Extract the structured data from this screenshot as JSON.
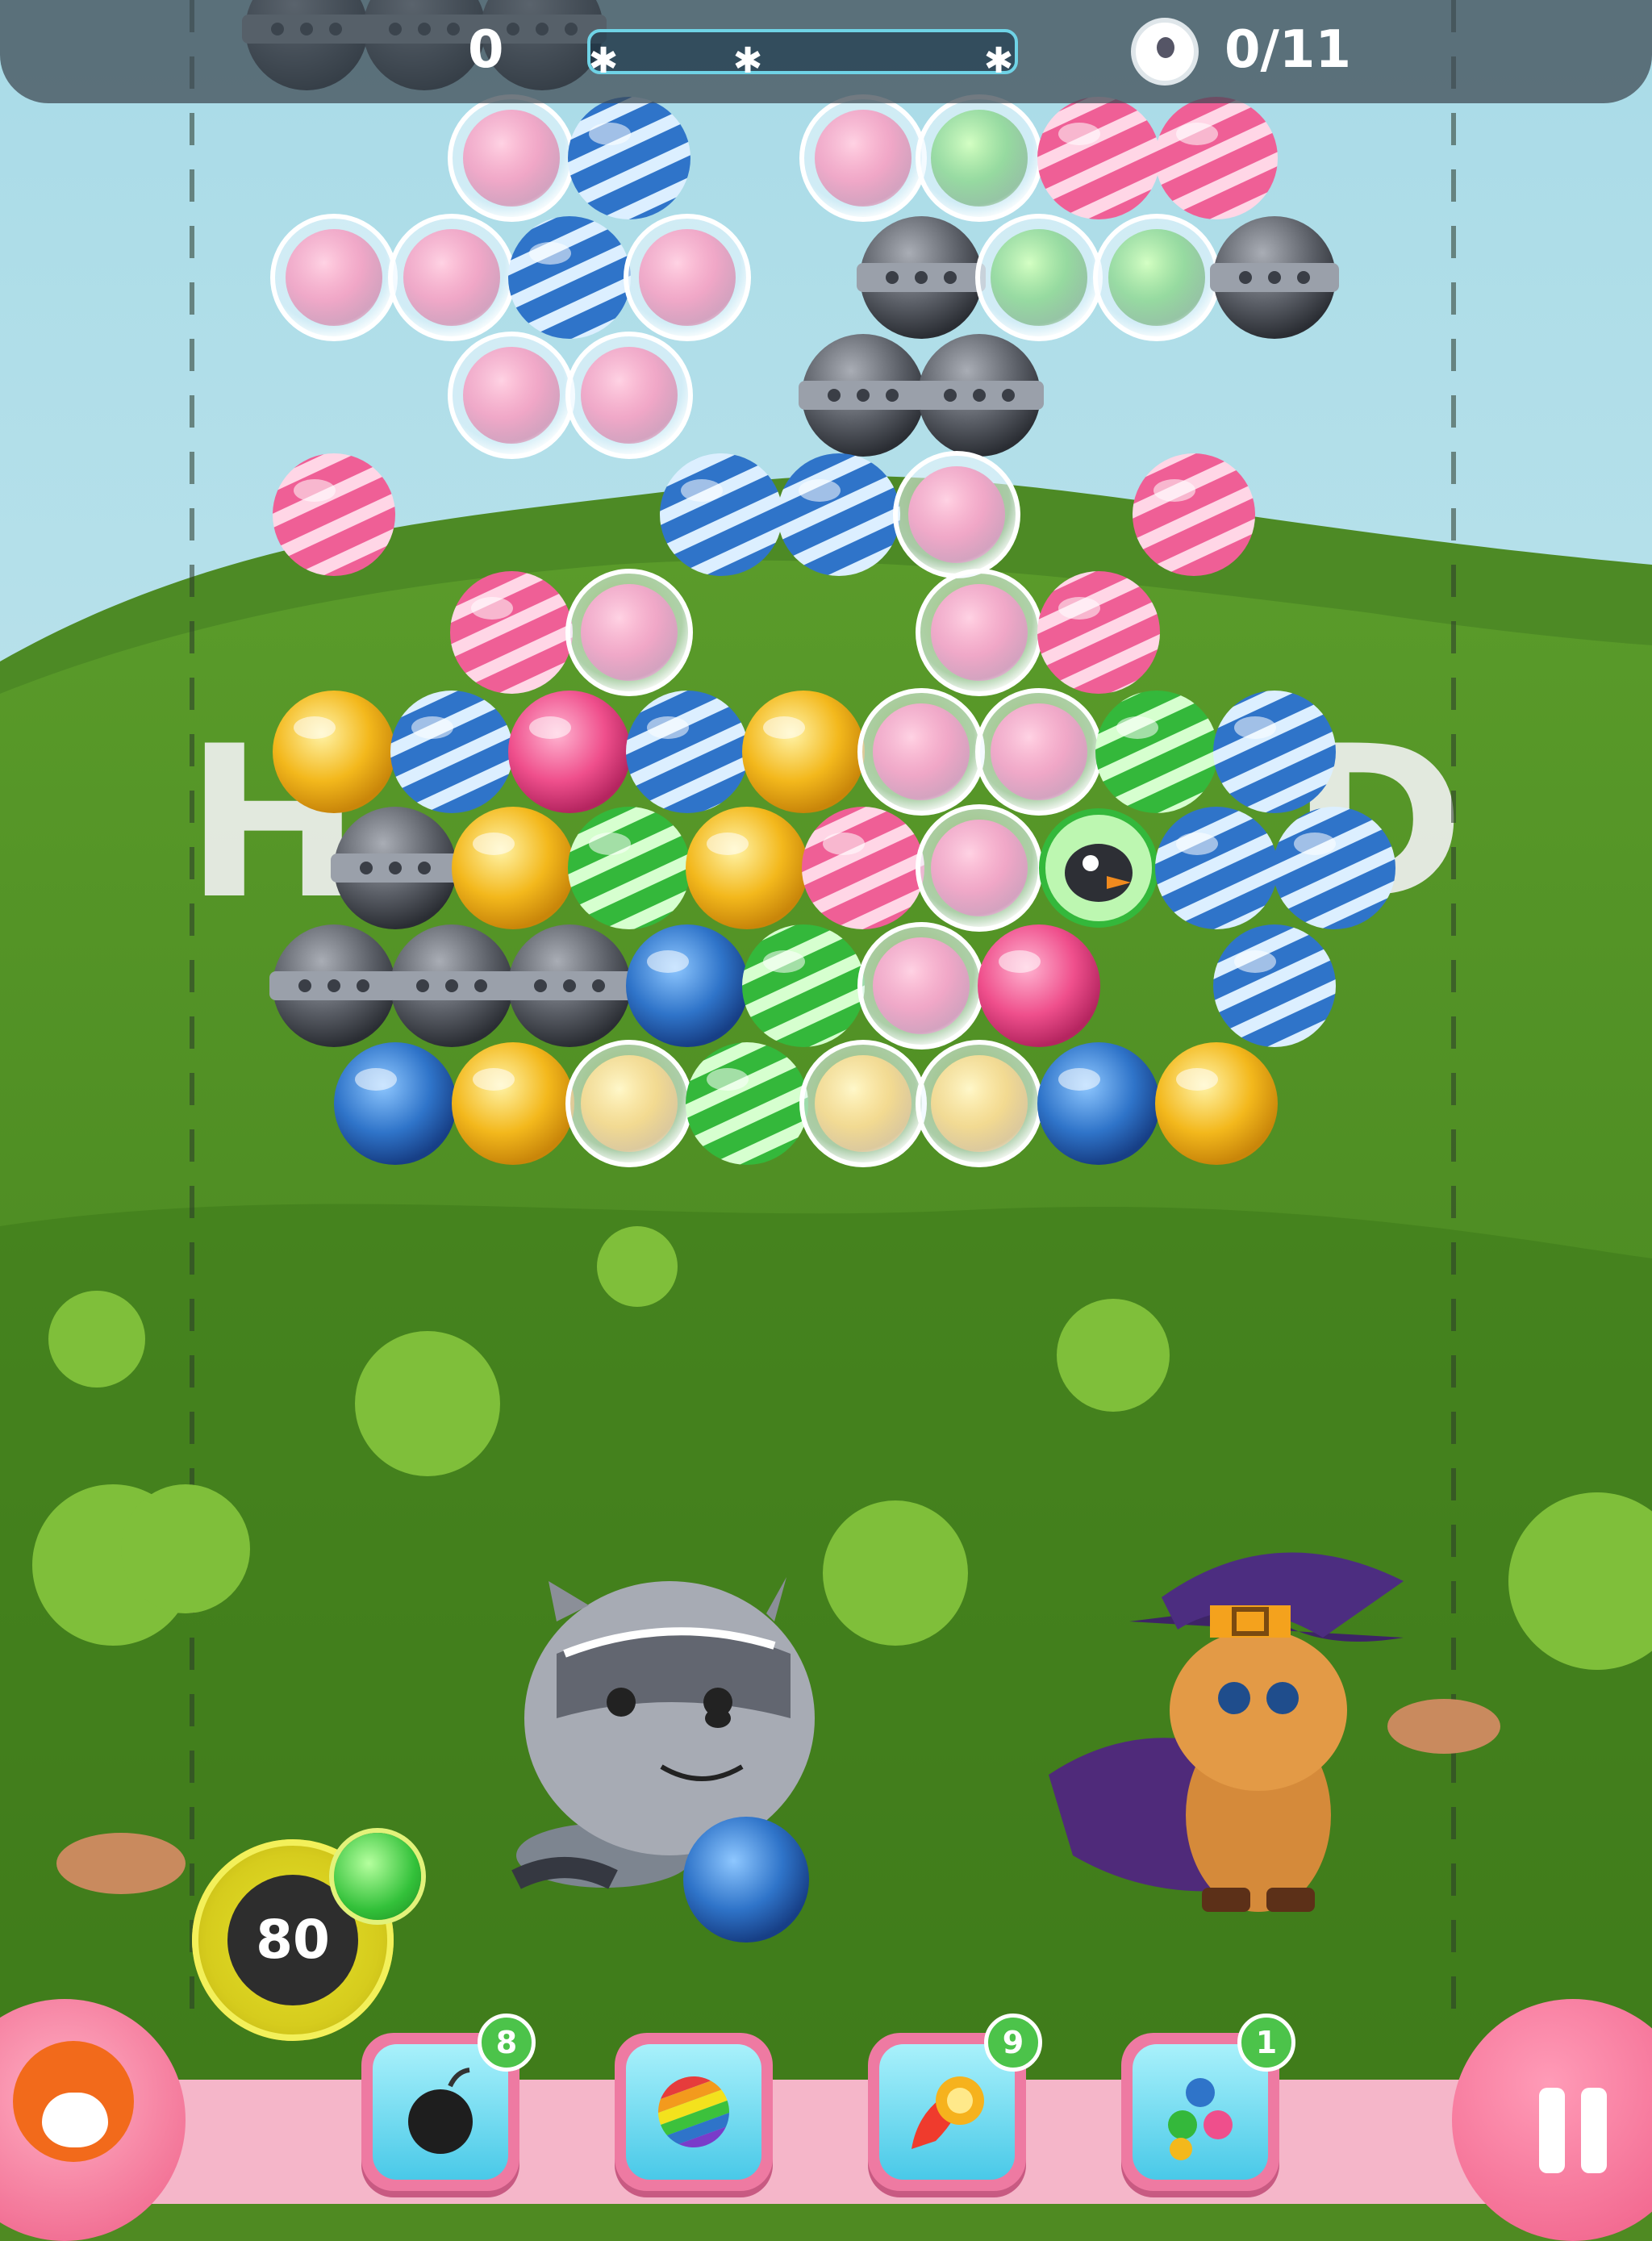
{
  "hud": {
    "score": "0",
    "goal_progress": "0/11",
    "score_progress_fraction": 0.0
  },
  "launcher": {
    "moves_left": "80",
    "current_bubble_color": "blue",
    "next_bubble_color": "green"
  },
  "boosters": [
    {
      "name": "bomb-booster",
      "icon": "bomb-icon",
      "count": "8"
    },
    {
      "name": "rainbow-booster",
      "icon": "rainbow-ball-icon",
      "count": ""
    },
    {
      "name": "fireball-booster",
      "icon": "fireball-icon",
      "count": "9"
    },
    {
      "name": "triple-color-booster",
      "icon": "color-swap-icon",
      "count": "1"
    }
  ],
  "colors": {
    "pink": "#ef4f8c",
    "blue": "#2f74c9",
    "green": "#34b83b",
    "yellow": "#f3b81c",
    "metal": "#5a5e66",
    "toolbar": "#f5b6c9"
  },
  "rows": [
    [
      "",
      "",
      "",
      "",
      "",
      "",
      "",
      ""
    ],
    [
      "metal-row-top"
    ],
    [],
    [],
    [],
    [],
    [],
    [],
    [],
    []
  ]
}
